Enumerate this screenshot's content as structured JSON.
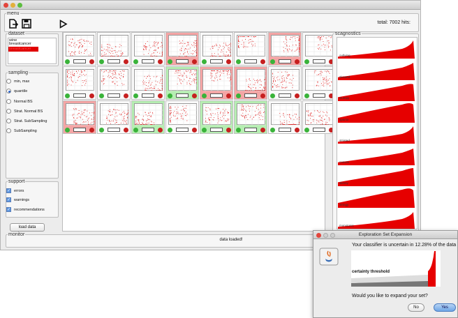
{
  "menu": {
    "legend": "menu",
    "new_icon": "new-document-icon",
    "save_icon": "save-icon",
    "play_icon": "play-icon",
    "total_label": "total: 7002 hits:"
  },
  "dataset": {
    "legend": "dataset",
    "items": [
      "wine",
      "breastcancer",
      "breastcancer"
    ],
    "selected_index": 2
  },
  "sampling": {
    "legend": "sampling",
    "options": [
      "min, max",
      "quantile",
      "Normal BS",
      "Strat. Normal BS",
      "Strat. SubSampling",
      "SubSampling"
    ],
    "selected_index": 1
  },
  "support": {
    "legend": "support",
    "options": [
      {
        "label": "errors",
        "checked": true
      },
      {
        "label": "warnings",
        "checked": true
      },
      {
        "label": "recommendations",
        "checked": true
      }
    ]
  },
  "load_button": "load data",
  "monitor": {
    "legend": "monitor",
    "status": "data loaded!"
  },
  "grid": {
    "cells": [
      [
        "normal",
        "normal",
        "normal",
        "red",
        "normal",
        "normal",
        "red",
        "normal"
      ],
      [
        "normal",
        "normal",
        "normal",
        "green",
        "red",
        "red",
        "normal",
        "normal"
      ],
      [
        "red",
        "normal",
        "green",
        "normal",
        "green",
        "green",
        "normal",
        "normal"
      ]
    ]
  },
  "scagnostics": {
    "legend": "scagnostics",
    "measures": [
      "outlying",
      "skewed",
      "clumpy",
      "sparse",
      "striated",
      "convex",
      "skinny",
      "stringy",
      "monotonic"
    ]
  },
  "dialog": {
    "title": "Exploration Set Expansion",
    "message": "Your classifier is uncertain in 12.28% of the data",
    "uncertain_percent": 12.28,
    "threshold_label": "certainty threshold",
    "question": "Would you like to expand your set?",
    "no_label": "No",
    "yes_label": "Yes",
    "app_icon": "java-app-icon"
  },
  "colors": {
    "accent": "#e60000",
    "positive": "#3ab33a",
    "negative": "#c62020",
    "selected": "#e00000"
  }
}
